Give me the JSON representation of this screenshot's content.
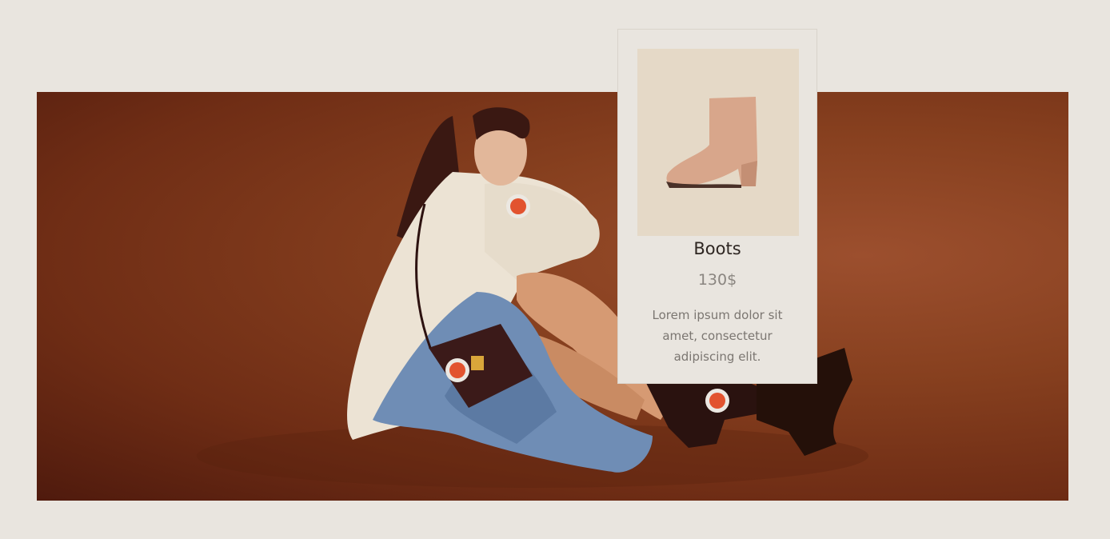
{
  "product_card": {
    "title": "Boots",
    "price": "130$",
    "description": "Lorem ipsum dolor sit amet, consectetur adipiscing elit."
  },
  "hotspots": [
    {
      "product": "sweater"
    },
    {
      "product": "bag"
    },
    {
      "product": "boots"
    }
  ],
  "colors": {
    "page_background": "#e9e5df",
    "banner_background": "#87401f",
    "hotspot_dot": "#e2532f",
    "card_image_background": "#e5d9c7"
  }
}
